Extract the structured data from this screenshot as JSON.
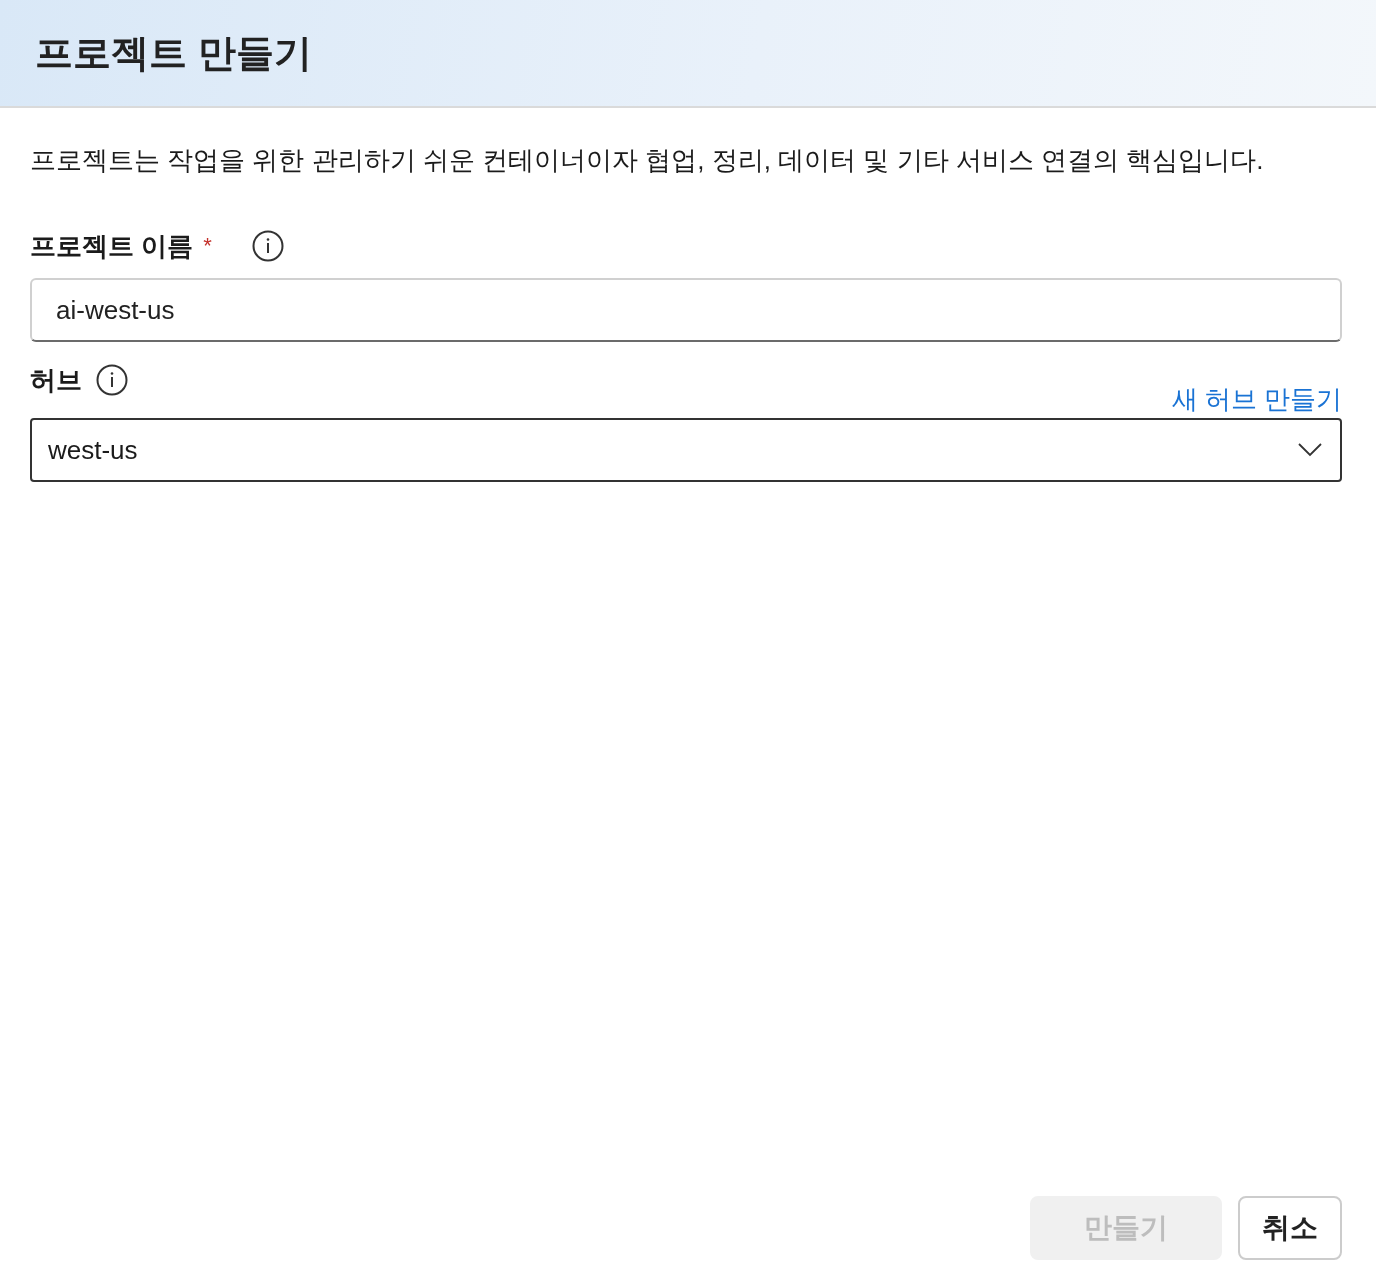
{
  "dialog": {
    "title": "프로젝트 만들기"
  },
  "description": "프로젝트는 작업을 위한 관리하기 쉬운 컨테이너이자 협업, 정리, 데이터 및 기타 서비스 연결의 핵심입니다.",
  "fields": [
    {
      "kind": "text",
      "label": "프로젝트 이름",
      "required_mark": "*",
      "value": "ai-west-us"
    },
    {
      "kind": "dropdown",
      "label": "허브",
      "link": "새 허브 만들기",
      "value": "west-us"
    }
  ],
  "buttons": [
    {
      "label": "만들기",
      "disabled": true
    },
    {
      "label": "취소",
      "disabled": false
    }
  ]
}
